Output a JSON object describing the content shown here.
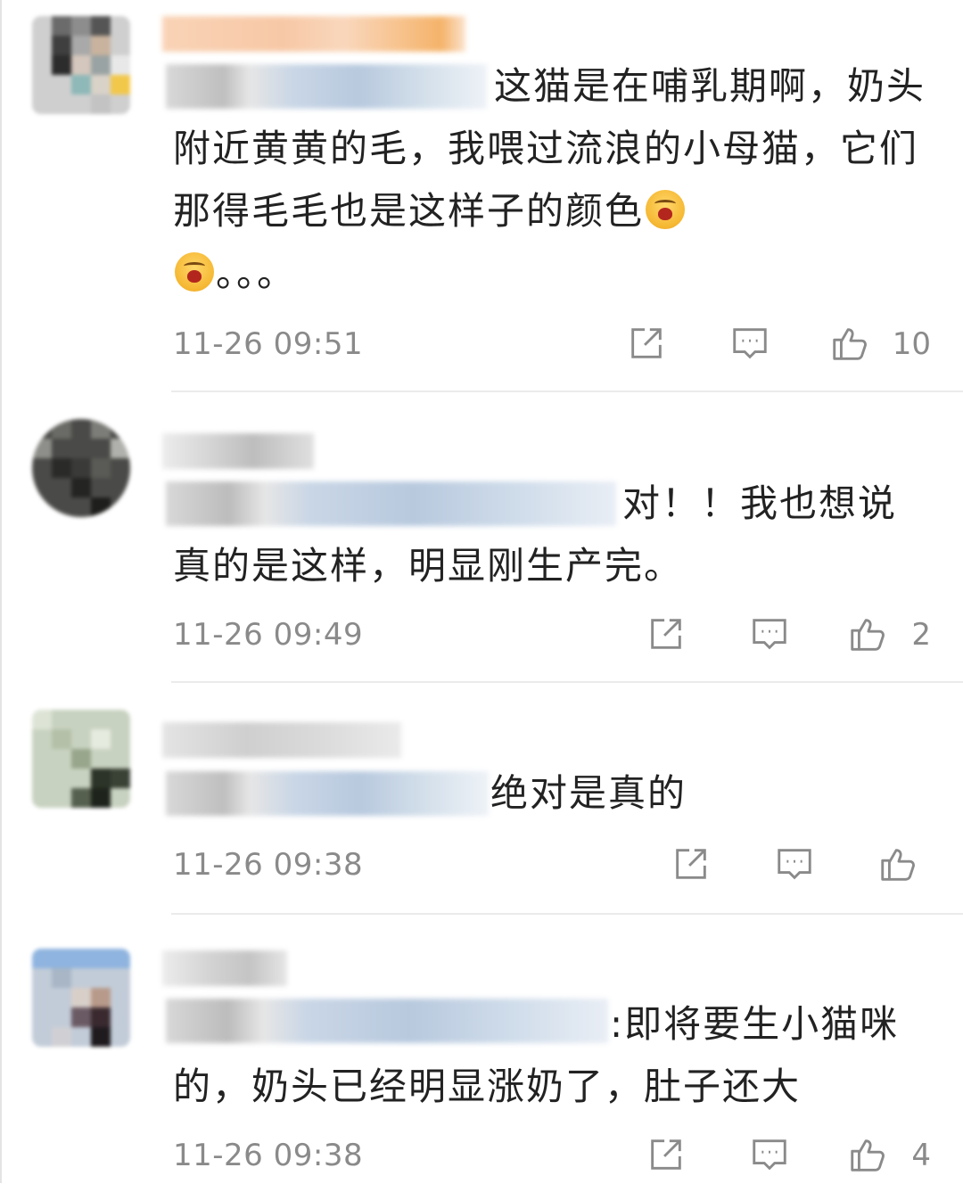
{
  "comments": [
    {
      "text_suffix": "这猫是在哺乳期啊，奶头附近黄黄的毛，我喂过流浪的小母猫，它们那得毛毛也是这样子的颜色",
      "text_end": "。。。",
      "timestamp": "11-26 09:51",
      "like_count": "10"
    },
    {
      "text_suffix": "对！！我也想说真的是这样，明显刚生产完。",
      "timestamp": "11-26 09:49",
      "like_count": "2"
    },
    {
      "text_suffix": "绝对是真的",
      "timestamp": "11-26 09:38",
      "like_count": ""
    },
    {
      "text_suffix": ":即将要生小猫咪的，奶头已经明显涨奶了，肚子还大",
      "timestamp": "11-26 09:38",
      "like_count": "4"
    }
  ],
  "icons": {
    "share": "share-icon",
    "comment": "comment-icon",
    "like": "thumbs-up-icon",
    "emoji": "crying-face-emoji"
  },
  "colors": {
    "text": "#222222",
    "meta": "#8a8a8a",
    "divider": "#ebebeb",
    "name_highlight": "#f5b36a"
  }
}
